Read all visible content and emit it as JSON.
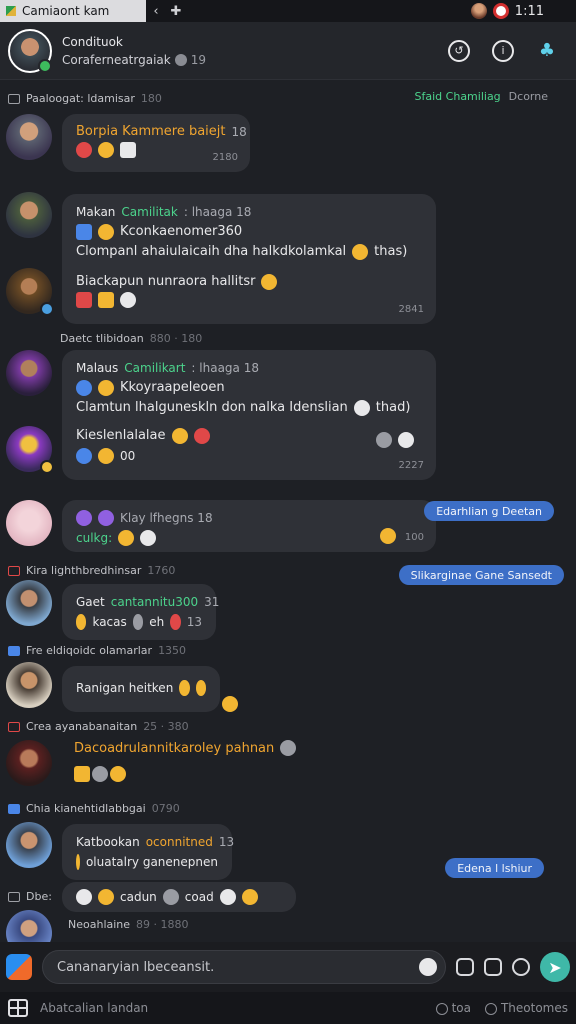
{
  "status_bar": {
    "app_title": "Camiaont kam",
    "time": "1:11"
  },
  "header": {
    "contact_name": "Condituok",
    "subtitle": "Coraferneatrgaiak",
    "subtitle_count": "19"
  },
  "rows": [
    {
      "meta": "Paaloogat: ldamisar",
      "num": "180",
      "right_green": "Sfaid Chamiliag",
      "right_grey": "Dcorne"
    },
    {
      "meta": "Daetc tlibidoan",
      "num": "880 · 180"
    },
    {
      "meta": "Kira lighthbredhinsar",
      "num": "1760"
    },
    {
      "meta": "Fre eldiqoidc olamarlar",
      "num": "1350"
    },
    {
      "meta": "Crea ayanabanaitan",
      "num": "25 · 380"
    },
    {
      "meta": "Chia kianehtidlabbgai",
      "num": "0790"
    },
    {
      "meta": "Dbe:"
    },
    {
      "meta": "Neoahlaine",
      "num": "89 · 1880"
    }
  ],
  "messages": [
    {
      "line1": "Borpia Kammere baiejt",
      "num1": "18",
      "time": "2180"
    },
    {
      "name": "Makan",
      "name_green": "Camilitak",
      "name_tail": ": lhaaga 18",
      "line2": "Kconkaenomer360",
      "line3": "Clompanl ahaiulaicaih dha halkdkolamkal",
      "line3_tail": "thas)",
      "line4": "Biackapun nunraora hallitsr",
      "time": "2841"
    },
    {
      "name": "Malaus",
      "name_green": "Camilikart",
      "name_tail": ": lhaaga 18",
      "line2": "Kkoyraapeleoen",
      "line3": "Clamtun lhalguneskln don nalka Idenslian",
      "line3_tail": "thad)",
      "line4": "Kieslenlalalae",
      "line5": "00",
      "time": "2227"
    },
    {
      "line1": "Klay lfhegns 18",
      "line2": "culkg:",
      "num": "100"
    },
    {
      "name": "Gaet",
      "name_green": "cantannitu300",
      "name_tail": "31",
      "line2": "kacas",
      "line2_b": "eh",
      "num": "13"
    },
    {
      "text": "Ranigan heitken"
    },
    {
      "line1": "Dacoadrulannitkaroley pahnan"
    },
    {
      "name": "Katbookan",
      "name_orange": "oconnitned",
      "num": "13",
      "line2": "oluatalry ganenepnen"
    },
    {
      "line1": "cadun",
      "line1_b": "coad"
    }
  ],
  "pills": [
    "Edarhlian g Deetan",
    "Slikarginae Gane Sansedt",
    "Edena l lshiur"
  ],
  "composer": {
    "placeholder": "Cananaryian lbeceansit."
  },
  "bottom_bar": {
    "hint": "Abatcalian landan",
    "item1": "toa",
    "item2": "Theotomes"
  }
}
